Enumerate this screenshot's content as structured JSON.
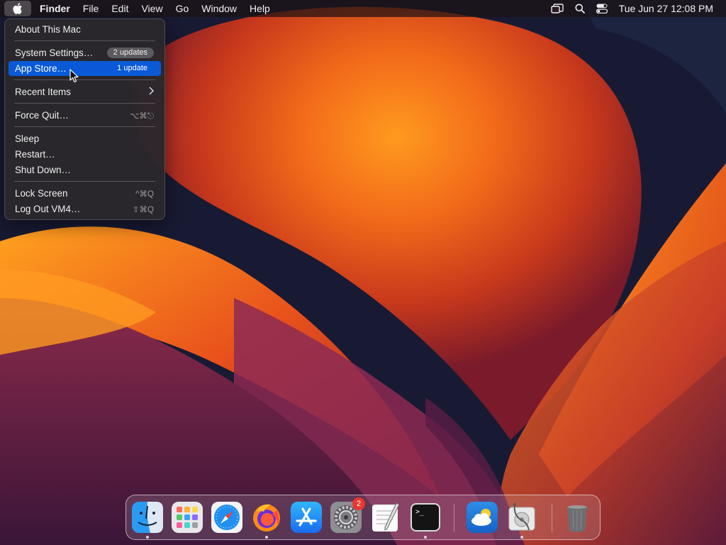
{
  "menubar": {
    "items": [
      "Finder",
      "File",
      "Edit",
      "View",
      "Go",
      "Window",
      "Help"
    ],
    "clock": "Tue Jun 27  12:08 PM",
    "icons": [
      "apple-logo-icon",
      "screen-mirroring-icon",
      "search-icon",
      "control-center-icon"
    ]
  },
  "apple_menu": {
    "about": "About This Mac",
    "system_settings": "System Settings…",
    "system_settings_badge": "2 updates",
    "app_store": "App Store…",
    "app_store_badge": "1 update",
    "recent_items": "Recent Items",
    "force_quit": "Force Quit…",
    "force_quit_shortcut": "⌥⌘⎋",
    "sleep": "Sleep",
    "restart": "Restart…",
    "shut_down": "Shut Down…",
    "lock_screen": "Lock Screen",
    "lock_screen_shortcut": "^⌘Q",
    "log_out": "Log Out VM4…",
    "log_out_shortcut": "⇧⌘Q"
  },
  "dock": {
    "apps": [
      "Finder",
      "Launchpad",
      "Safari",
      "Firefox",
      "App Store",
      "System Settings",
      "TextEdit",
      "Terminal",
      "Weather",
      "Disk Utility",
      "Trash"
    ],
    "system_settings_badge": "2",
    "terminal_prompt": ">_"
  },
  "colors": {
    "menu_highlight": "#0a5ad8",
    "wallpaper_orange": "#f57a1c",
    "wallpaper_dark": "#1c1330"
  }
}
